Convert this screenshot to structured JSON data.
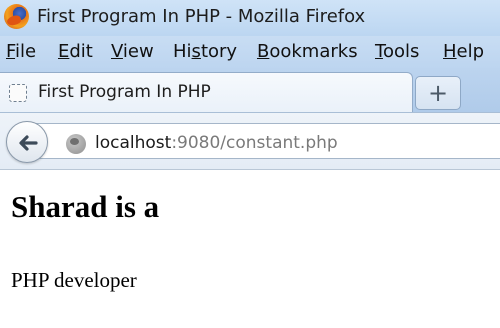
{
  "window": {
    "title": "First Program In PHP - Mozilla Firefox",
    "app_icon": "firefox-icon"
  },
  "menubar": {
    "items": [
      {
        "accel": "F",
        "rest": "ile"
      },
      {
        "accel": "E",
        "rest": "dit"
      },
      {
        "accel": "V",
        "rest": "iew"
      },
      {
        "pre": "Hi",
        "accel": "s",
        "rest": "tory"
      },
      {
        "accel": "B",
        "rest": "ookmarks"
      },
      {
        "accel": "T",
        "rest": "ools"
      },
      {
        "accel": "H",
        "rest": "elp"
      }
    ]
  },
  "tabs": {
    "active_label": "First Program In PHP",
    "favicon": "blank-page-icon",
    "new_tab_symbol": "+"
  },
  "navbar": {
    "back_icon": "back-arrow-icon",
    "site_icon": "globe-icon",
    "url_host": "localhost",
    "url_rest": ":9080/constant.php"
  },
  "page": {
    "heading": "Sharad is a",
    "paragraph": "PHP developer"
  }
}
